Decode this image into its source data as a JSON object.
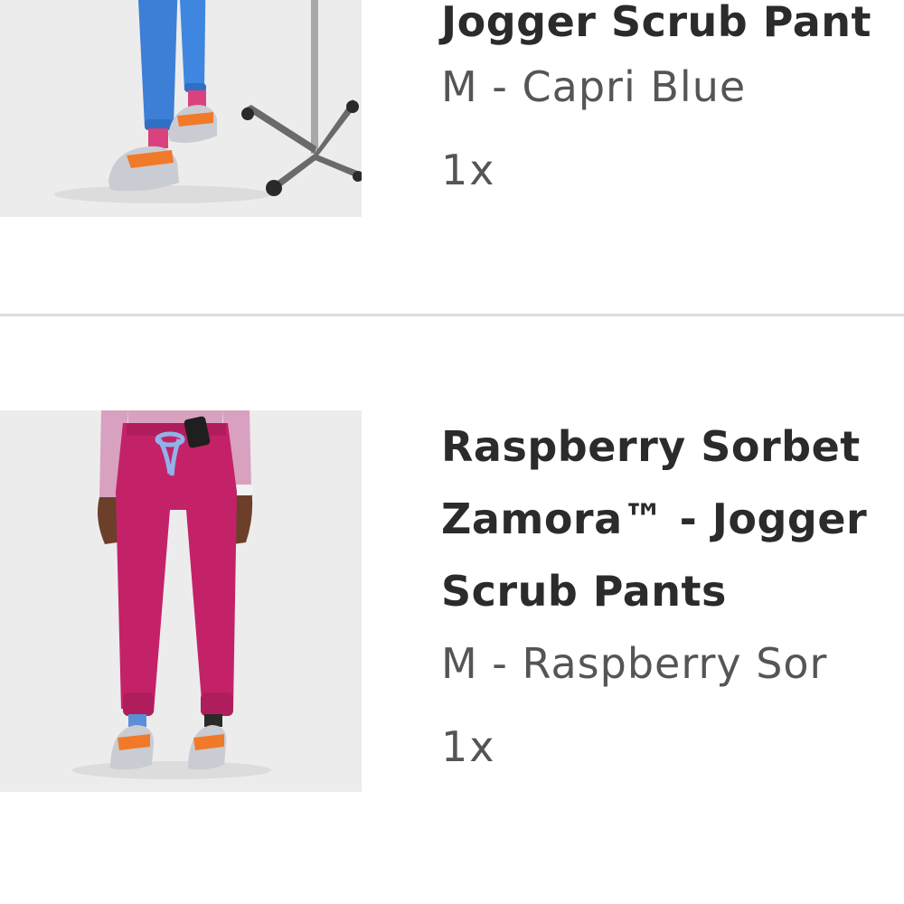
{
  "cart": {
    "items": [
      {
        "name": "Jogger Scrub Pant",
        "variant": "M - Capri Blue",
        "quantity": "1x",
        "image_color": "#3d7fd6"
      },
      {
        "name": "Raspberry Sorbet\nZamora™ - Jogger\nScrub Pants",
        "variant": "M - Raspberry Sor",
        "quantity": "1x",
        "image_color": "#c42268"
      }
    ]
  }
}
